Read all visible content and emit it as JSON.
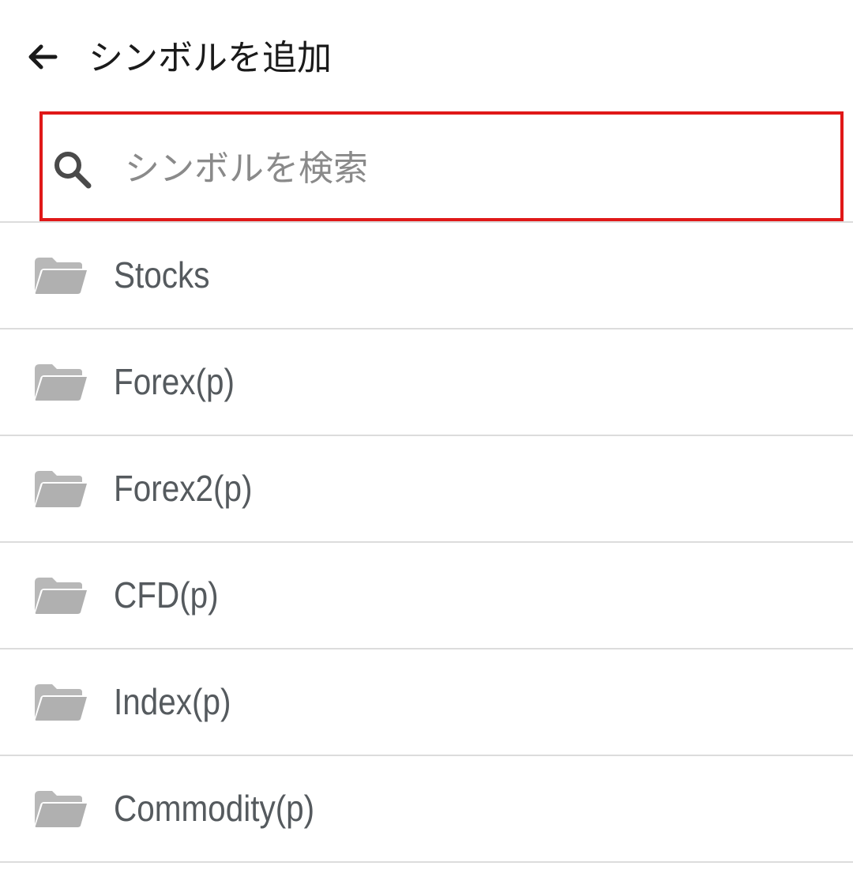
{
  "header": {
    "title": "シンボルを追加",
    "back_icon": "arrow-left-icon"
  },
  "search": {
    "placeholder": "シンボルを検索",
    "value": "",
    "icon": "search-icon",
    "highlight_color": "#e01818"
  },
  "folders": {
    "icon": "folder-icon",
    "icon_color": "#b0b0b0",
    "items": [
      {
        "label": "Stocks"
      },
      {
        "label": "Forex(p)"
      },
      {
        "label": "Forex2(p)"
      },
      {
        "label": "CFD(p)"
      },
      {
        "label": "Index(p)"
      },
      {
        "label": "Commodity(p)"
      }
    ]
  }
}
